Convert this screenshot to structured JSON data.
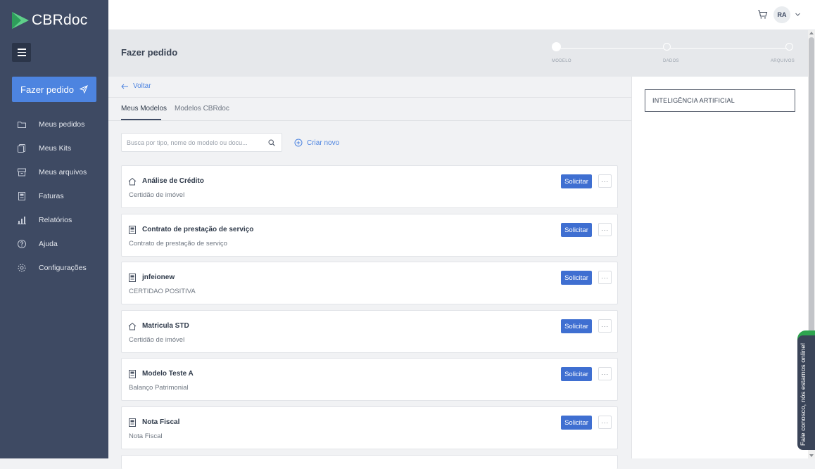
{
  "brand": {
    "logo_text": "CBRdoc"
  },
  "sidebar": {
    "order_button": "Fazer pedido",
    "items": [
      {
        "label": "Meus pedidos",
        "icon": "folder-icon"
      },
      {
        "label": "Meus Kits",
        "icon": "documents-icon"
      },
      {
        "label": "Meus arquivos",
        "icon": "archive-icon"
      },
      {
        "label": "Faturas",
        "icon": "invoice-icon"
      },
      {
        "label": "Relatórios",
        "icon": "bar-chart-icon"
      },
      {
        "label": "Ajuda",
        "icon": "help-icon"
      },
      {
        "label": "Configurações",
        "icon": "gear-icon"
      }
    ]
  },
  "topbar": {
    "user_initials": "RA"
  },
  "header": {
    "title": "Fazer pedido",
    "steps": [
      "MODELO",
      "DADOS",
      "ARQUIVOS"
    ]
  },
  "main": {
    "back": "Voltar",
    "tabs": [
      "Meus Modelos",
      "Modelos CBRdoc"
    ],
    "search_placeholder": "Busca por tipo, nome do modelo ou docu...",
    "create_new": "Criar novo",
    "request_label": "Solicitar",
    "more_label": "···",
    "cards": [
      {
        "title": "Análise de Crédito",
        "subtitle": "Certidão de imóvel",
        "icon": "house-icon"
      },
      {
        "title": "Contrato de prestação de serviço",
        "subtitle": "Contrato de prestação de serviço",
        "icon": "document-icon"
      },
      {
        "title": "jnfeionew",
        "subtitle": "CERTIDAO POSITIVA",
        "icon": "document-icon"
      },
      {
        "title": "Matricula STD",
        "subtitle": "Certidão de imóvel",
        "icon": "house-icon"
      },
      {
        "title": "Modelo Teste A",
        "subtitle": "Balanço Patrimonial",
        "icon": "document-icon"
      },
      {
        "title": "Nota Fiscal",
        "subtitle": "Nota Fiscal",
        "icon": "document-icon"
      }
    ]
  },
  "right_panel": {
    "ai_label": "INTELIGÊNCIA ARTIFICIAL"
  },
  "chat": {
    "label": "Fale conosco, nós estamos online!"
  },
  "colors": {
    "sidebar": "#3e4a63",
    "accent": "#4d84e0",
    "button": "#3f6fd1",
    "online": "#2ea44f"
  }
}
